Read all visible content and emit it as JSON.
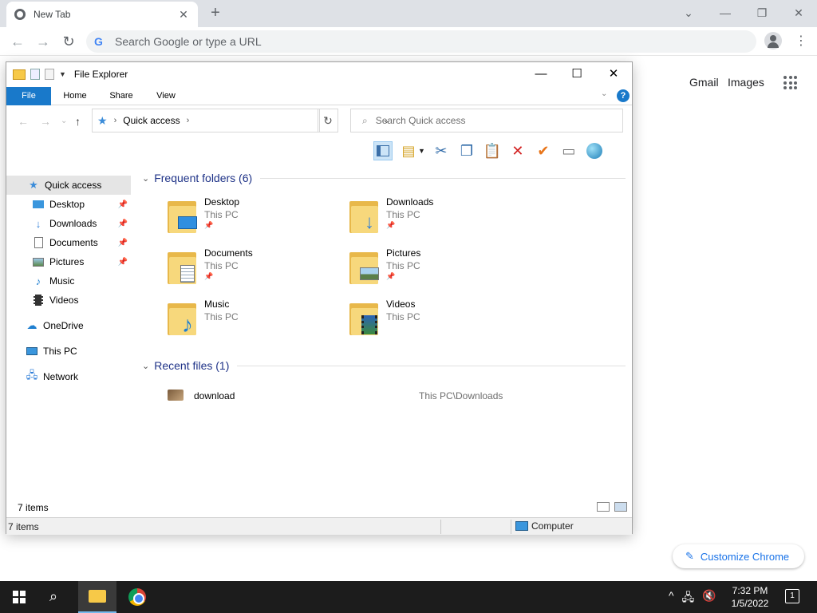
{
  "chrome": {
    "tab_title": "New Tab",
    "tab_close": "✕",
    "new_tab": "+",
    "omnibox_placeholder": "Search Google or type a URL",
    "g_logo": "G",
    "links": {
      "gmail": "Gmail",
      "images": "Images"
    },
    "customize": "Customize Chrome",
    "window_controls": {
      "dropdown": "⌄",
      "minimize": "—",
      "restore": "❐",
      "close": "✕"
    }
  },
  "explorer": {
    "title": "File Explorer",
    "controls": {
      "minimize": "—",
      "maximize": "☐",
      "close": "✕"
    },
    "ribbon": {
      "file": "File",
      "home": "Home",
      "share": "Share",
      "view": "View",
      "help": "?"
    },
    "address": {
      "crumb": "Quick access"
    },
    "search_placeholder": "Search Quick access",
    "nav": [
      {
        "label": "Quick access",
        "icon": "star-icon",
        "pinned": false
      },
      {
        "label": "Desktop",
        "icon": "desktop-icon",
        "pinned": true
      },
      {
        "label": "Downloads",
        "icon": "download-arrow-icon",
        "pinned": true
      },
      {
        "label": "Documents",
        "icon": "document-icon",
        "pinned": true
      },
      {
        "label": "Pictures",
        "icon": "picture-icon",
        "pinned": true
      },
      {
        "label": "Music",
        "icon": "music-note-icon",
        "pinned": false
      },
      {
        "label": "Videos",
        "icon": "film-icon",
        "pinned": false
      },
      {
        "label": "OneDrive",
        "icon": "cloud-icon",
        "pinned": false
      },
      {
        "label": "This PC",
        "icon": "computer-icon",
        "pinned": false
      },
      {
        "label": "Network",
        "icon": "network-icon",
        "pinned": false
      }
    ],
    "frequent_header": "Frequent folders (6)",
    "frequent": [
      {
        "name": "Desktop",
        "location": "This PC",
        "pinned": true,
        "overlay": "desktop-icon"
      },
      {
        "name": "Downloads",
        "location": "This PC",
        "pinned": true,
        "overlay": "download-arrow-icon"
      },
      {
        "name": "Documents",
        "location": "This PC",
        "pinned": true,
        "overlay": "document-icon"
      },
      {
        "name": "Pictures",
        "location": "This PC",
        "pinned": true,
        "overlay": "picture-icon"
      },
      {
        "name": "Music",
        "location": "This PC",
        "pinned": false,
        "overlay": "music-note-icon"
      },
      {
        "name": "Videos",
        "location": "This PC",
        "pinned": false,
        "overlay": "film-icon"
      }
    ],
    "recent_header": "Recent files (1)",
    "recent": [
      {
        "name": "download",
        "path": "This PC\\Downloads"
      }
    ],
    "status_items": "7 items",
    "status_bar_items": "7 items",
    "status_location": "Computer"
  },
  "taskbar": {
    "time": "7:32 PM",
    "date": "1/5/2022",
    "notification_count": "1"
  },
  "colors": {
    "accent": "#1979ca",
    "folder": "#f7d87c",
    "chrome_link": "#1a73e8",
    "taskbar": "#1c1c1c"
  }
}
